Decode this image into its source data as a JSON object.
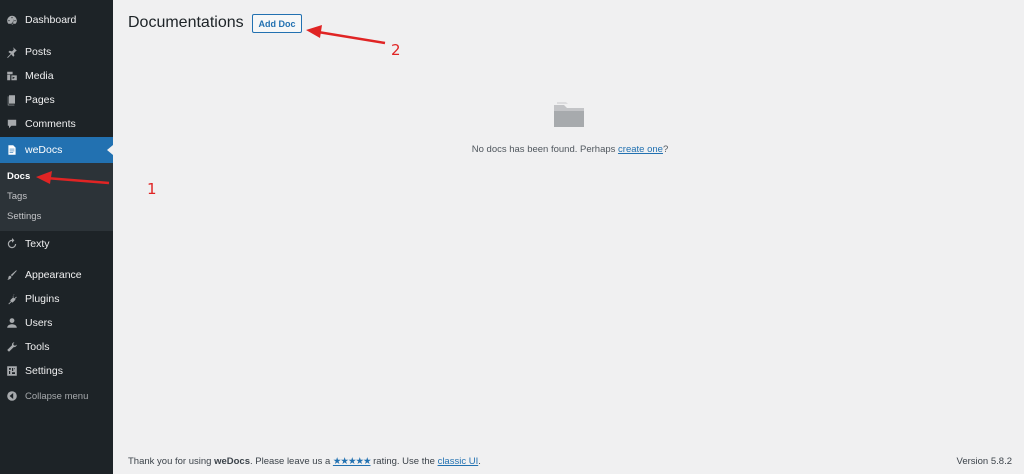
{
  "sidebar": {
    "items": [
      {
        "label": "Dashboard",
        "icon": "dashboard-icon"
      },
      {
        "label": "Posts",
        "icon": "pin-icon"
      },
      {
        "label": "Media",
        "icon": "media-icon"
      },
      {
        "label": "Pages",
        "icon": "pages-icon"
      },
      {
        "label": "Comments",
        "icon": "comment-icon"
      },
      {
        "label": "weDocs",
        "icon": "doc-icon"
      },
      {
        "label": "Texty",
        "icon": "refresh-icon"
      },
      {
        "label": "Appearance",
        "icon": "brush-icon"
      },
      {
        "label": "Plugins",
        "icon": "plug-icon"
      },
      {
        "label": "Users",
        "icon": "user-icon"
      },
      {
        "label": "Tools",
        "icon": "wrench-icon"
      },
      {
        "label": "Settings",
        "icon": "settings-icon"
      },
      {
        "label": "Collapse menu",
        "icon": "collapse-icon"
      }
    ],
    "submenu": [
      {
        "label": "Docs"
      },
      {
        "label": "Tags"
      },
      {
        "label": "Settings"
      }
    ]
  },
  "header": {
    "title": "Documentations",
    "add_button": "Add Doc"
  },
  "empty_state": {
    "icon": "folder-icon",
    "text_before": "No docs has been found. Perhaps ",
    "link": "create one",
    "text_after": "?"
  },
  "annotations": {
    "one": "1",
    "two": "2"
  },
  "footer": {
    "prefix": "Thank you for using ",
    "plugin": "weDocs",
    "middle": ". Please leave us a ",
    "stars": "★★★★★",
    "rating_text": " rating. Use the ",
    "link": "classic UI",
    "suffix": ".",
    "version": "Version 5.8.2"
  },
  "colors": {
    "sidebar_bg": "#1d2327",
    "accent": "#2271b1",
    "annotation": "#e02424",
    "page_bg": "#f0f0f1"
  }
}
